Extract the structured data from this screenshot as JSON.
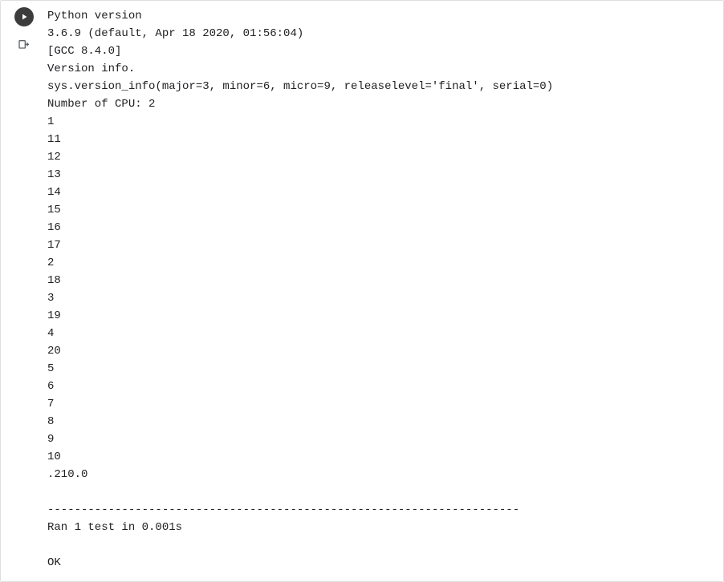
{
  "output": {
    "lines": [
      "Python version",
      "3.6.9 (default, Apr 18 2020, 01:56:04) ",
      "[GCC 8.4.0]",
      "Version info.",
      "sys.version_info(major=3, minor=6, micro=9, releaselevel='final', serial=0)",
      "Number of CPU: 2",
      "1",
      "11",
      "12",
      "13",
      "14",
      "15",
      "16",
      "17",
      "2",
      "18",
      "3",
      "19",
      "4",
      "20",
      "5",
      "6",
      "7",
      "8",
      "9",
      "10",
      ".210.0",
      "",
      "----------------------------------------------------------------------",
      "Ran 1 test in 0.001s",
      "",
      "OK"
    ]
  }
}
